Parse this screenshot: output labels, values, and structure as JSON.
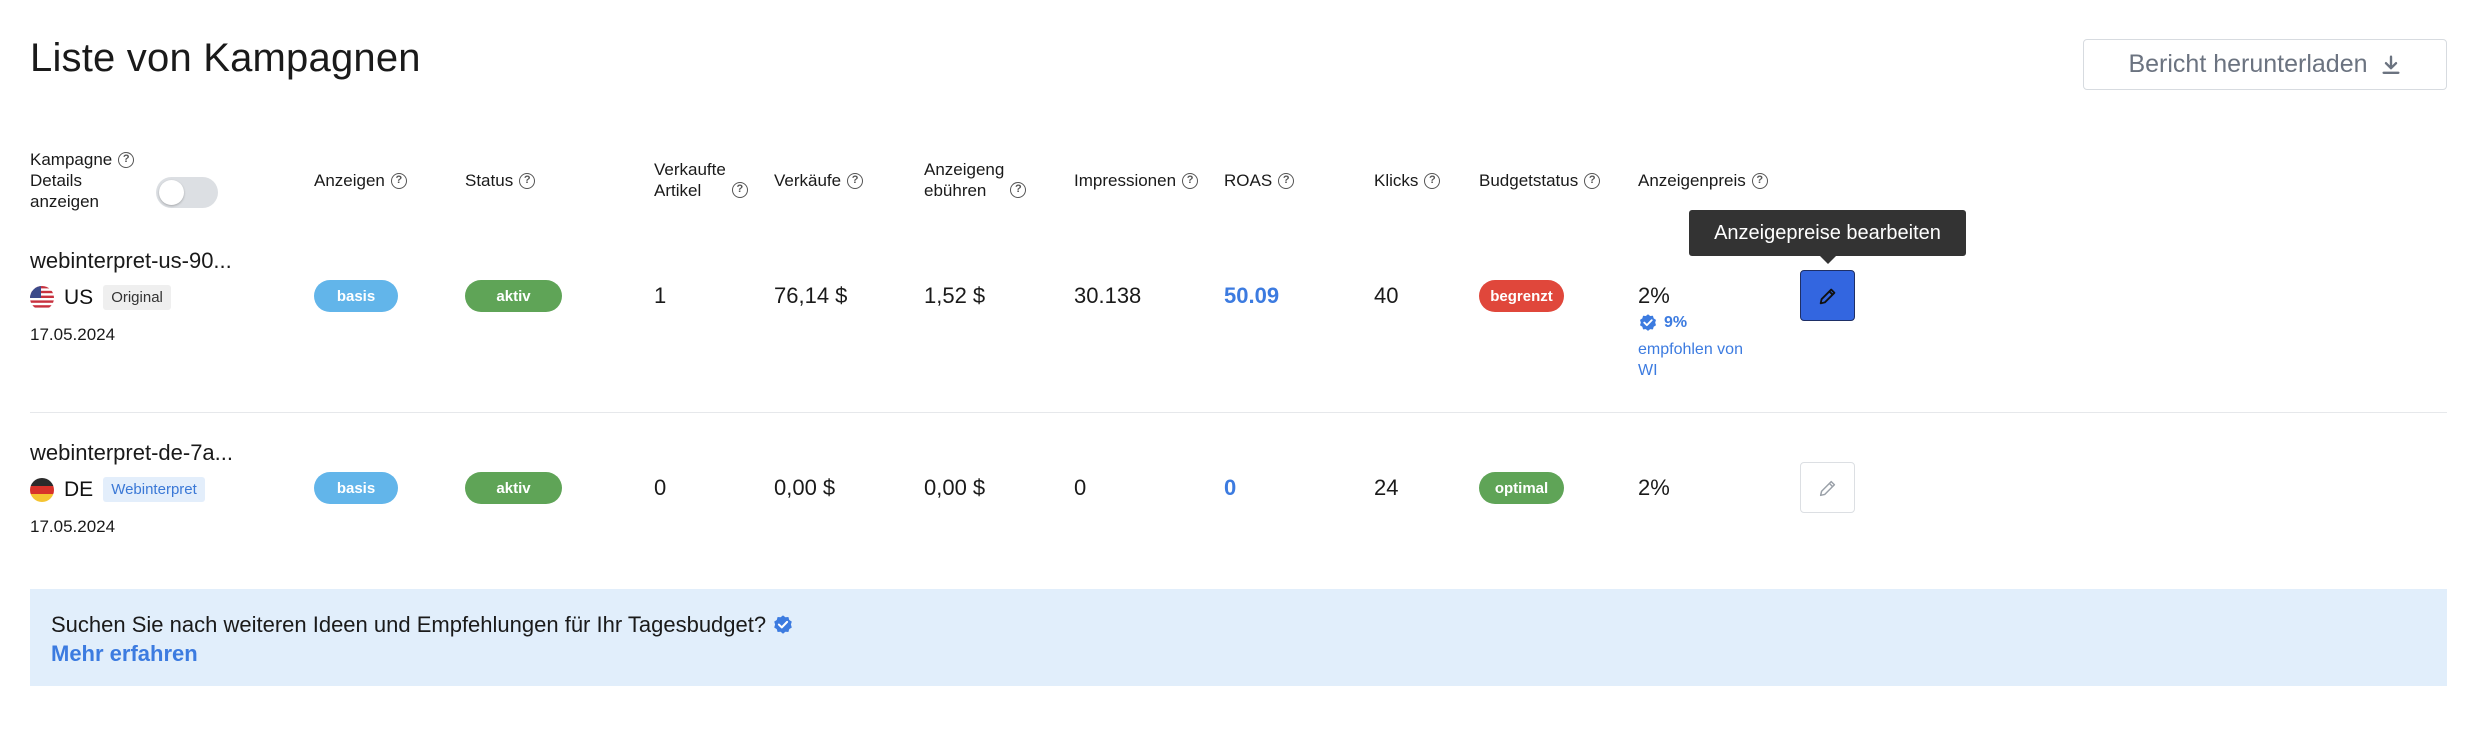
{
  "page": {
    "title": "Liste von Kampagnen"
  },
  "report_button": {
    "label": "Bericht herunterladen",
    "icon": "download-icon"
  },
  "columns": {
    "kampagne": "Kampagne",
    "details_line1": "Details",
    "details_line2": "anzeigen",
    "anzeigen": "Anzeigen",
    "status": "Status",
    "verkaufte_line1": "Verkaufte",
    "verkaufte_line2": "Artikel",
    "verkaeufe": "Verkäufe",
    "gebuehren_line1": "Anzeigeng",
    "gebuehren_line2": "ebühren",
    "impressionen": "Impressionen",
    "roas": "ROAS",
    "klicks": "Klicks",
    "budgetstatus": "Budgetstatus",
    "anzeigenpreis": "Anzeigenpreis"
  },
  "details_toggle": {
    "on": false
  },
  "rows": [
    {
      "name": "webinterpret-us-90...",
      "country": "US",
      "tag": "Original",
      "date": "17.05.2024",
      "ads": "basis",
      "status": "aktiv",
      "sold_items": "1",
      "sales": "76,14 $",
      "fees": "1,52 $",
      "impressions": "30.138",
      "roas": "50.09",
      "clicks": "40",
      "budget_status": "begrenzt",
      "ad_price": "2%",
      "recommended_pct": "9%",
      "recommended_line1": "empfohlen von",
      "recommended_line2": "WI"
    },
    {
      "name": "webinterpret-de-7a...",
      "country": "DE",
      "tag": "Webinterpret",
      "date": "17.05.2024",
      "ads": "basis",
      "status": "aktiv",
      "sold_items": "0",
      "sales": "0,00 $",
      "fees": "0,00 $",
      "impressions": "0",
      "roas": "0",
      "clicks": "24",
      "budget_status": "optimal",
      "ad_price": "2%"
    }
  ],
  "tooltip": {
    "text": "Anzeigepreise bearbeiten"
  },
  "banner": {
    "text": "Suchen Sie nach weiteren Ideen und Empfehlungen für Ihr Tagesbudget?",
    "link": "Mehr erfahren"
  },
  "colors": {
    "accent_blue": "#3c7be0",
    "edit_active": "#3366e0",
    "pill_basis": "#62b5ea",
    "pill_aktiv": "#5fa457",
    "pill_begrenzt": "#e0473b",
    "banner_bg": "#e1eefb"
  }
}
